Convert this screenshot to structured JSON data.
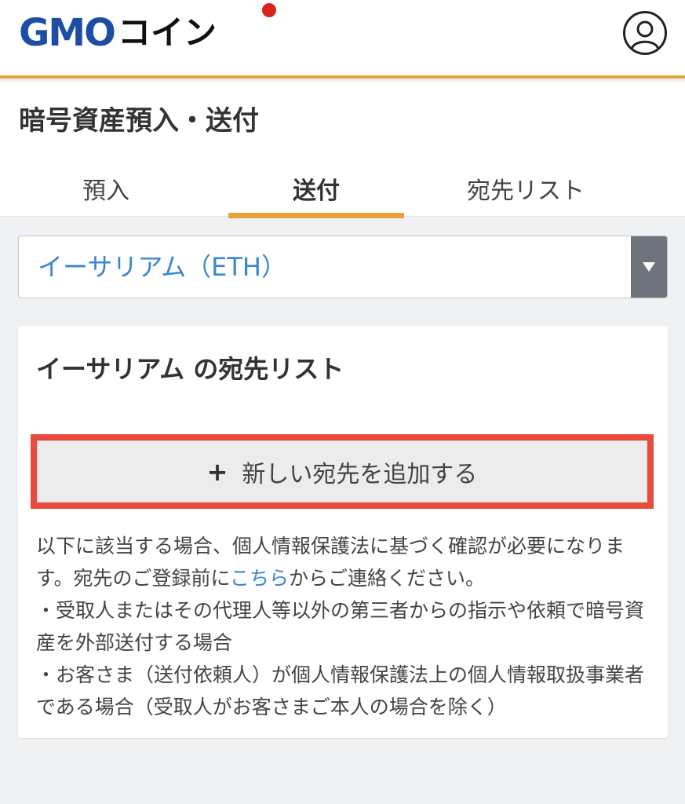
{
  "header": {
    "logo_gmo": "GMO",
    "logo_coin": "コイン",
    "brand_colors": {
      "gmo_blue": "#1d4ea5",
      "accent_orange": "#e8a23a",
      "red_dot": "#d9231c"
    },
    "user_icon": "user-icon"
  },
  "page": {
    "title": "暗号資産預入・送付"
  },
  "tabs": [
    {
      "label": "預入",
      "active": false
    },
    {
      "label": "送付",
      "active": true
    },
    {
      "label": "宛先リスト",
      "active": false
    }
  ],
  "currency_select": {
    "value": "イーサリアム（ETH）",
    "arrow_icon": "caret-down-icon"
  },
  "card": {
    "title": "イーサリアム の宛先リスト",
    "add_button": {
      "icon": "plus-icon",
      "plus": "+",
      "label": "新しい宛先を追加する",
      "highlight_color": "#e74c3c"
    },
    "notes": {
      "intro_before_link": "以下に該当する場合、個人情報保護法に基づく確認が必要になります。宛先のご登録前に",
      "link": "こちら",
      "intro_after_link": "からご連絡ください。",
      "bullet1": "・受取人またはその代理人等以外の第三者からの指示や依頼で暗号資産を外部送付する場合",
      "bullet2": "・お客さま（送付依頼人）が個人情報保護法上の個人情報取扱事業者である場合（受取人がお客さまご本人の場合を除く）"
    }
  }
}
